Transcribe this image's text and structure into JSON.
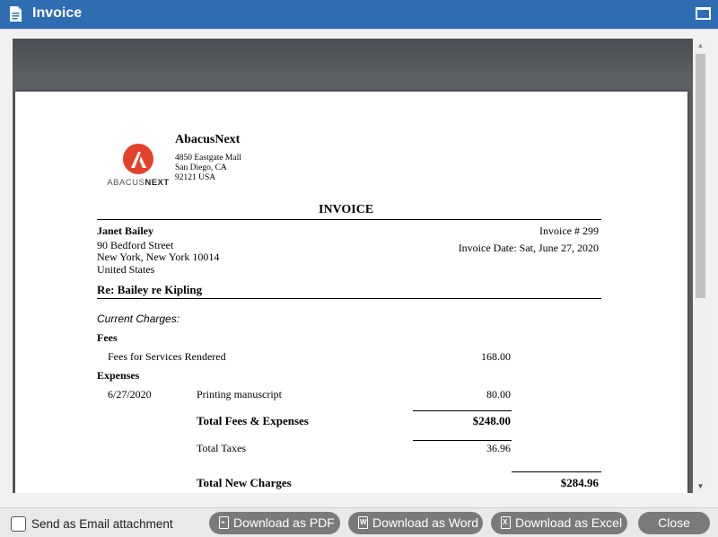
{
  "window": {
    "title": "Invoice",
    "icon": "document-icon",
    "maximize_icon": "maximize-icon"
  },
  "invoice": {
    "firm": {
      "name": "AbacusNext",
      "address1": "4850 Eastgate Mall",
      "address2": "San Diego, CA",
      "address3": "92121  USA",
      "logo_text_a": "ABACUS",
      "logo_text_b": "NEXT"
    },
    "heading": "INVOICE",
    "client": {
      "name": "Janet Bailey",
      "street": "90 Bedford Street",
      "city": "New York, New York 10014",
      "country": "United States"
    },
    "invoice_number": "Invoice # 299",
    "invoice_date": "Invoice Date: Sat, June 27, 2020",
    "re": "Re: Bailey re Kipling",
    "current_charges": "Current Charges:",
    "fees_heading": "Fees",
    "fees_line": {
      "label": "Fees for Services Rendered",
      "amount": "168.00"
    },
    "expenses_heading": "Expenses",
    "expense_line": {
      "date": "6/27/2020",
      "label": "Printing manuscript",
      "amount": "80.00"
    },
    "total_fees_expenses": {
      "label": "Total Fees & Expenses",
      "amount": "$248.00"
    },
    "total_taxes": {
      "label": "Total Taxes",
      "amount": "36.96"
    },
    "total_new_charges": {
      "label": "Total New Charges",
      "amount": "$284.96"
    }
  },
  "footer": {
    "email_checkbox_label": "Send as Email attachment",
    "email_checked": false,
    "buttons": {
      "pdf": "Download as PDF",
      "word": "Download as Word",
      "excel": "Download as Excel",
      "close": "Close"
    }
  },
  "colors": {
    "titlebar": "#2f6db3",
    "button": "#7a7a7a",
    "logo_red": "#e2422b"
  }
}
